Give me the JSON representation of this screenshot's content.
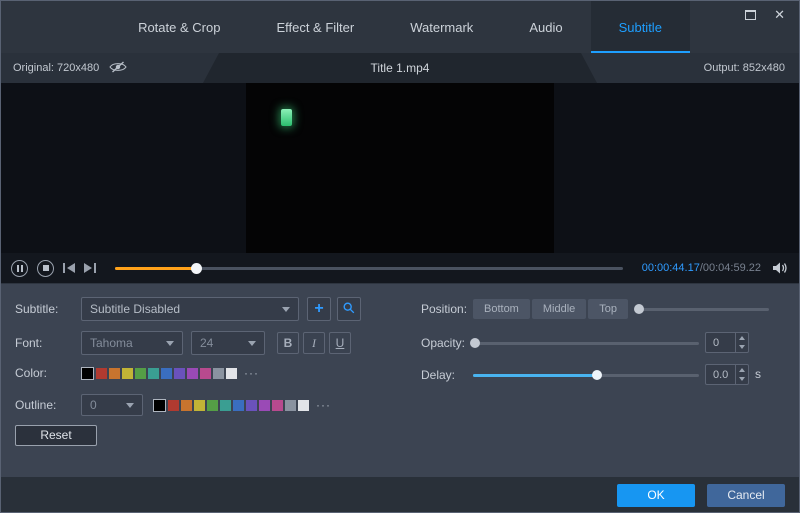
{
  "window": {
    "close_icon": "✕"
  },
  "tabs": [
    "Rotate & Crop",
    "Effect & Filter",
    "Watermark",
    "Audio",
    "Subtitle"
  ],
  "strip": {
    "original": "Original: 720x480",
    "title": "Title 1.mp4",
    "output": "Output: 852x480"
  },
  "player": {
    "current_time": "00:00:44.17",
    "total_time": "/00:04:59.22",
    "progress_percent": 16
  },
  "panel": {
    "subtitle": {
      "label": "Subtitle:",
      "value": "Subtitle Disabled",
      "add": "+"
    },
    "font": {
      "label": "Font:",
      "family": "Tahoma",
      "size": "24",
      "bold": "B",
      "italic": "I",
      "underline": "U"
    },
    "color": {
      "label": "Color:",
      "current": "#000000",
      "palette": [
        "#b03a30",
        "#c8742e",
        "#c2b436",
        "#559e46",
        "#3a9e92",
        "#3a6ec0",
        "#6a52bc",
        "#9a4ab6",
        "#b84a8e",
        "#8a93a0",
        "#e2e4e8"
      ],
      "more": "···"
    },
    "outline": {
      "label": "Outline:",
      "width": "0",
      "current": "#000000",
      "palette": [
        "#b03a30",
        "#c8742e",
        "#c2b436",
        "#559e46",
        "#3a9e92",
        "#3a6ec0",
        "#6a52bc",
        "#9a4ab6",
        "#b84a8e",
        "#8a93a0",
        "#e2e4e8"
      ],
      "more": "···"
    },
    "reset": "Reset",
    "position": {
      "label": "Position:",
      "options": [
        "Bottom",
        "Middle",
        "Top"
      ],
      "percent": 3
    },
    "opacity": {
      "label": "Opacity:",
      "value": "0",
      "percent": 1
    },
    "delay": {
      "label": "Delay:",
      "value": "0.0",
      "unit": "s",
      "percent": 55
    }
  },
  "footer": {
    "ok": "OK",
    "cancel": "Cancel"
  },
  "colors": {
    "accent": "#1e9fff",
    "progress": "#ffa21a",
    "delay_fill": "#49b4f0"
  }
}
